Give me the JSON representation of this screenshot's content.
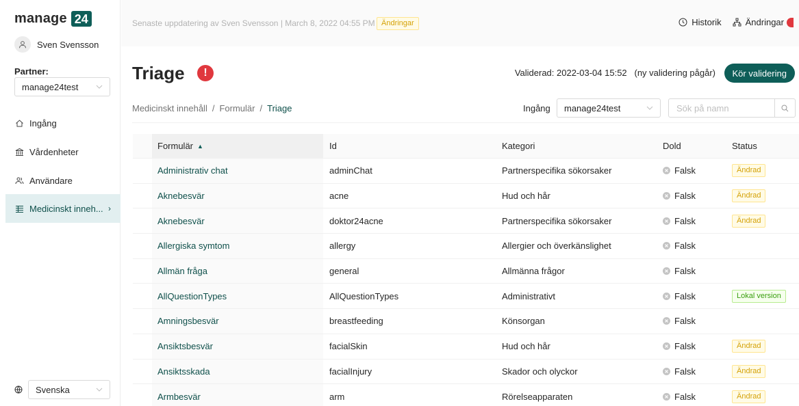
{
  "sidebar": {
    "logo_text": "manage",
    "logo_badge": "24",
    "user_name": "Sven Svensson",
    "partner_label": "Partner:",
    "partner_value": "manage24test",
    "nav": [
      {
        "label": "Ingång",
        "icon": "home-icon"
      },
      {
        "label": "Vårdenheter",
        "icon": "bank-icon"
      },
      {
        "label": "Användare",
        "icon": "users-icon"
      },
      {
        "label": "Medicinskt inneh...",
        "icon": "list-icon",
        "active": true
      }
    ],
    "language": "Svenska"
  },
  "topbar": {
    "update_text": "Senaste uppdatering av Sven Svensson | March 8, 2022 04:55 PM",
    "update_badge": "Ändringar",
    "history_label": "Historik",
    "changes_label": "Ändringar"
  },
  "header": {
    "title": "Triage",
    "alert_symbol": "!",
    "validated_text": "Validerad: 2022-03-04 15:52   (ny validering pågår)",
    "run_button": "Kör validering"
  },
  "breadcrumb": {
    "items": [
      "Medicinskt innehåll",
      "Formulär",
      "Triage"
    ],
    "separator": "/"
  },
  "filters": {
    "entry_label": "Ingång",
    "entry_value": "manage24test",
    "search_placeholder": "Sök på namn"
  },
  "table": {
    "columns": [
      "Formulär",
      "Id",
      "Kategori",
      "Dold",
      "Status"
    ],
    "rows": [
      {
        "form": "Administrativ chat",
        "id": "adminChat",
        "category": "Partnerspecifika sökorsaker",
        "hidden": "Falsk",
        "status": "Ändrad"
      },
      {
        "form": "Aknebesvär",
        "id": "acne",
        "category": "Hud och hår",
        "hidden": "Falsk",
        "status": "Ändrad"
      },
      {
        "form": "Aknebesvär",
        "id": "doktor24acne",
        "category": "Partnerspecifika sökorsaker",
        "hidden": "Falsk",
        "status": "Ändrad"
      },
      {
        "form": "Allergiska symtom",
        "id": "allergy",
        "category": "Allergier och överkänslighet",
        "hidden": "Falsk",
        "status": ""
      },
      {
        "form": "Allmän fråga",
        "id": "general",
        "category": "Allmänna frågor",
        "hidden": "Falsk",
        "status": ""
      },
      {
        "form": "AllQuestionTypes",
        "id": "AllQuestionTypes",
        "category": "Administrativt",
        "hidden": "Falsk",
        "status": "Lokal version"
      },
      {
        "form": "Amningsbesvär",
        "id": "breastfeeding",
        "category": "Könsorgan",
        "hidden": "Falsk",
        "status": ""
      },
      {
        "form": "Ansiktsbesvär",
        "id": "facialSkin",
        "category": "Hud och hår",
        "hidden": "Falsk",
        "status": "Ändrad"
      },
      {
        "form": "Ansiktsskada",
        "id": "facialInjury",
        "category": "Skador och olyckor",
        "hidden": "Falsk",
        "status": "Ändrad"
      },
      {
        "form": "Armbesvär",
        "id": "arm",
        "category": "Rörelseapparaten",
        "hidden": "Falsk",
        "status": "Ändrad"
      }
    ]
  },
  "colors": {
    "brand": "#0e5e58",
    "alert": "#e0383e",
    "changed_badge": "#d4a106",
    "local_badge": "#389e0d"
  }
}
